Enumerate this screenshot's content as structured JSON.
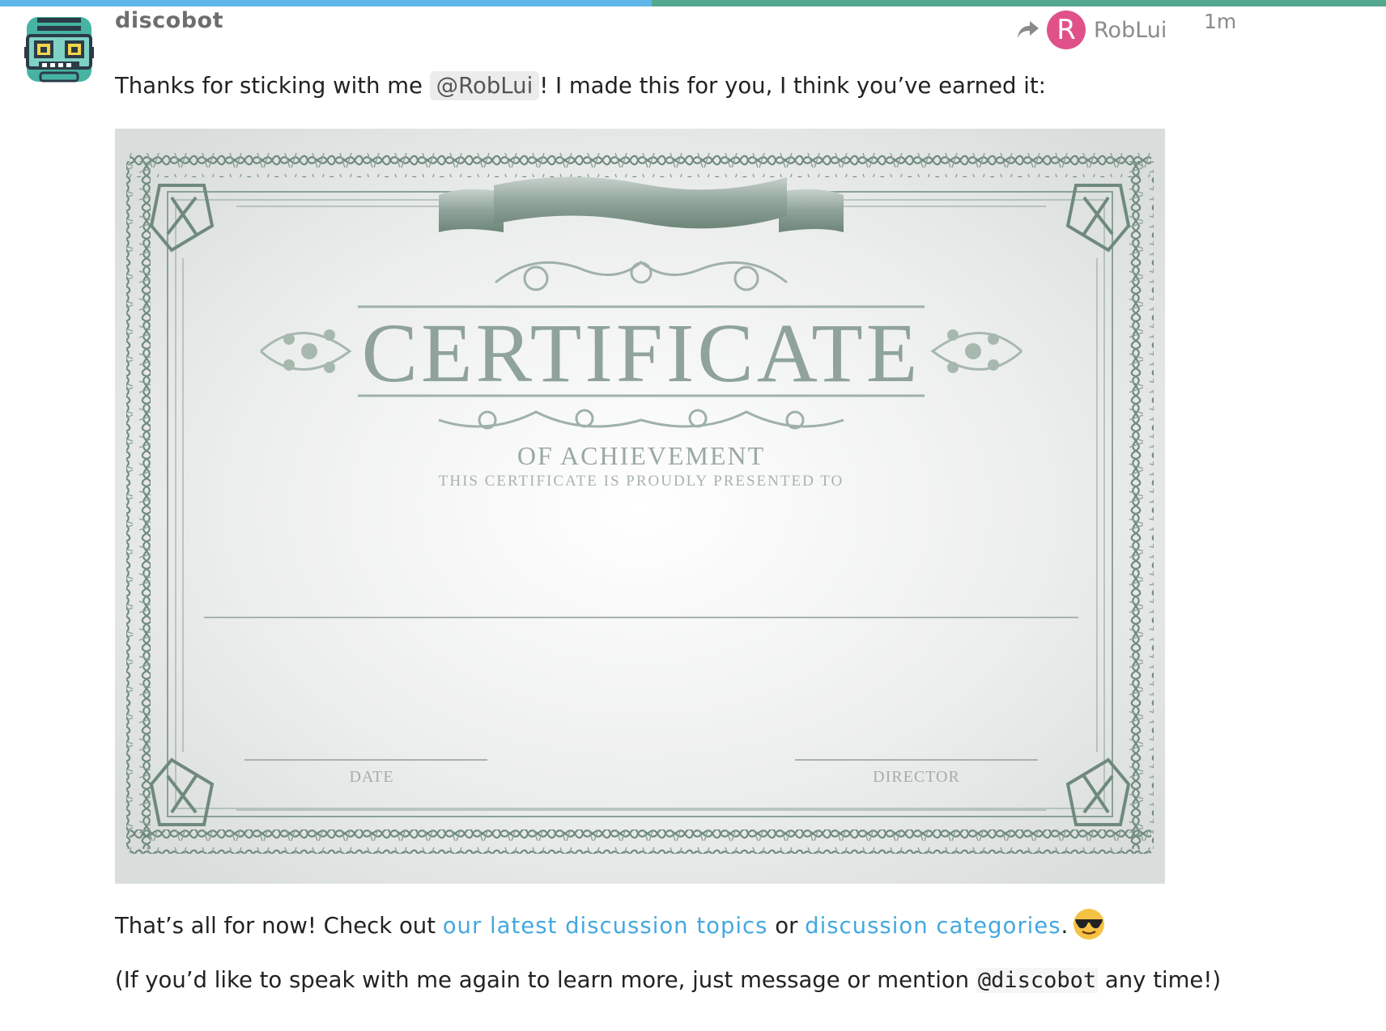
{
  "progress": {
    "fraction": 0.47
  },
  "post": {
    "username": "discobot",
    "avatar_icon": "robot-avatar-icon",
    "reply_to": {
      "icon": "reply-arrow-icon",
      "avatar_letter": "R",
      "avatar_color": "#e0518a",
      "name": "RobLui"
    },
    "time": "1m",
    "line1": {
      "before": "Thanks for sticking with me ",
      "mention": "@RobLui",
      "after": "! I made this for you, I think you’ve earned it:"
    },
    "certificate": {
      "title": "CERTIFICATE",
      "subtitle": "OF ACHIEVEMENT",
      "presented": "THIS CERTIFICATE IS PROUDLY PRESENTED TO",
      "date_label": "DATE",
      "director_label": "DIRECTOR"
    },
    "line2": {
      "before": "That’s all for now! Check out ",
      "link1": "our latest discussion topics",
      "middle": " or ",
      "link2": "discussion categories",
      "after": ".",
      "emoji": "sunglasses-emoji-icon"
    },
    "line3": {
      "before": "(If you’d like to speak with me again to learn more, just message or mention ",
      "code": "@discobot",
      "after": " any time!)"
    }
  },
  "colors": {
    "accent_blue": "#5fb6e8",
    "accent_green": "#53a88e",
    "link": "#44a8e0",
    "cert_ornament": "#6f8a7d"
  }
}
